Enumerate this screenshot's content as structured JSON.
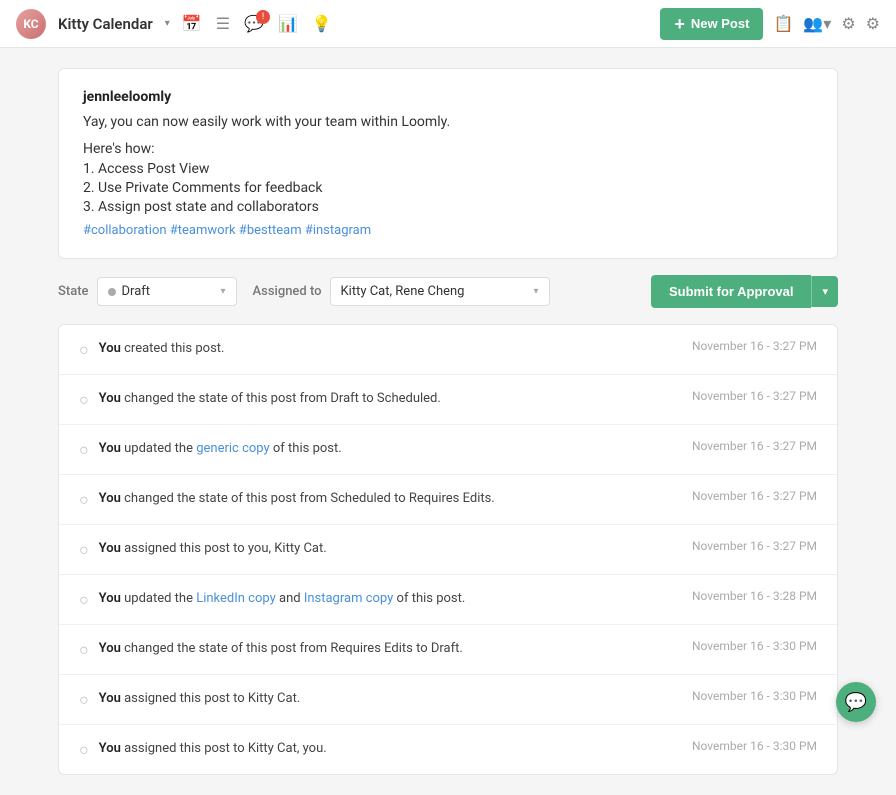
{
  "brand": {
    "name": "Kitty Calendar",
    "dropdown_icon": "▾",
    "avatar_initials": "KC"
  },
  "nav": {
    "icons": [
      {
        "name": "calendar-icon",
        "glyph": "📅"
      },
      {
        "name": "list-icon",
        "glyph": "☰"
      },
      {
        "name": "comment-icon",
        "glyph": "💬"
      },
      {
        "name": "chart-icon",
        "glyph": "📊"
      },
      {
        "name": "bulb-icon",
        "glyph": "💡"
      }
    ],
    "right_icons": [
      {
        "name": "copy-icon",
        "glyph": "📋"
      },
      {
        "name": "team-icon",
        "glyph": "👥"
      },
      {
        "name": "settings-icon",
        "glyph": "⚙"
      },
      {
        "name": "help-icon",
        "glyph": "⚙"
      }
    ],
    "new_post_label": "New Post"
  },
  "post": {
    "username": "jennleeloomly",
    "body": "Yay, you can now easily work with your team within Loomly.",
    "how_label": "Here's how:",
    "steps": [
      "1. Access Post View",
      "2. Use Private Comments for feedback",
      "3. Assign post state and collaborators"
    ],
    "hashtags": "#collaboration #teamwork #bestteam #instagram"
  },
  "state_bar": {
    "state_label": "State",
    "state_value": "Draft",
    "state_dot_class": "draft",
    "assigned_label": "Assigned to",
    "assigned_value": "Kitty Cat, Rene Cheng",
    "submit_label": "Submit for Approval"
  },
  "activity": [
    {
      "text_parts": [
        {
          "type": "bold",
          "text": "You"
        },
        {
          "type": "plain",
          "text": " created this post."
        }
      ],
      "time": "November 16 - 3:27 PM"
    },
    {
      "text_parts": [
        {
          "type": "bold",
          "text": "You"
        },
        {
          "type": "plain",
          "text": " changed the state of this post from Draft to Scheduled."
        }
      ],
      "time": "November 16 - 3:27 PM"
    },
    {
      "text_parts": [
        {
          "type": "bold",
          "text": "You"
        },
        {
          "type": "plain",
          "text": " updated the "
        },
        {
          "type": "link",
          "text": "generic copy"
        },
        {
          "type": "plain",
          "text": " of this post."
        }
      ],
      "time": "November 16 - 3:27 PM"
    },
    {
      "text_parts": [
        {
          "type": "bold",
          "text": "You"
        },
        {
          "type": "plain",
          "text": " changed the state of this post from Scheduled to Requires Edits."
        }
      ],
      "time": "November 16 - 3:27 PM"
    },
    {
      "text_parts": [
        {
          "type": "bold",
          "text": "You"
        },
        {
          "type": "plain",
          "text": " assigned this post to you, Kitty Cat."
        }
      ],
      "time": "November 16 - 3:27 PM"
    },
    {
      "text_parts": [
        {
          "type": "bold",
          "text": "You"
        },
        {
          "type": "plain",
          "text": " updated the "
        },
        {
          "type": "link",
          "text": "LinkedIn copy"
        },
        {
          "type": "plain",
          "text": " and "
        },
        {
          "type": "link",
          "text": "Instagram copy"
        },
        {
          "type": "plain",
          "text": " of this post."
        }
      ],
      "time": "November 16 - 3:28 PM"
    },
    {
      "text_parts": [
        {
          "type": "bold",
          "text": "You"
        },
        {
          "type": "plain",
          "text": " changed the state of this post from Requires Edits to Draft."
        }
      ],
      "time": "November 16 - 3:30 PM"
    },
    {
      "text_parts": [
        {
          "type": "bold",
          "text": "You"
        },
        {
          "type": "plain",
          "text": " assigned this post to Kitty Cat."
        }
      ],
      "time": "November 16 - 3:30 PM"
    },
    {
      "text_parts": [
        {
          "type": "bold",
          "text": "You"
        },
        {
          "type": "plain",
          "text": " assigned this post to Kitty Cat, you."
        }
      ],
      "time": "November 16 - 3:30 PM"
    }
  ]
}
